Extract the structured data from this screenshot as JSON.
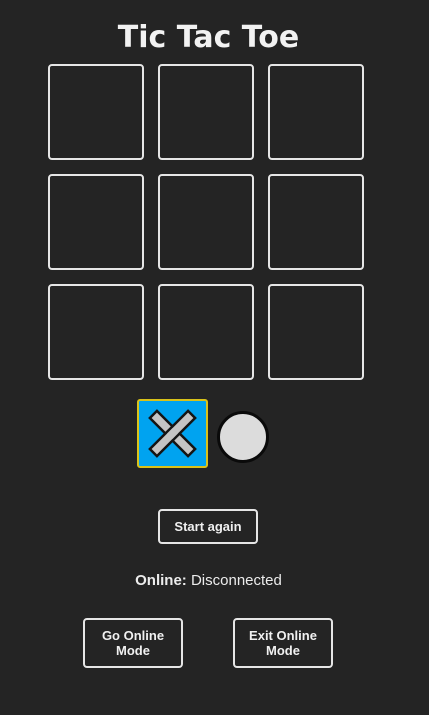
{
  "title": "Tic Tac Toe",
  "board": {
    "cells": [
      "",
      "",
      "",
      "",
      "",
      "",
      "",
      "",
      ""
    ]
  },
  "players": {
    "x_symbol": "x-icon",
    "o_symbol": "o-icon",
    "active": "x",
    "colors": {
      "active_bg": "#00a3f0",
      "active_border": "#d9c21a",
      "mark_fill": "#c4c4c4",
      "o_fill": "#dcdcdc"
    }
  },
  "controls": {
    "start_again_label": "Start again",
    "go_online_label": "Go Online Mode",
    "exit_online_label": "Exit Online Mode"
  },
  "status": {
    "label": "Online:",
    "value": "Disconnected"
  }
}
